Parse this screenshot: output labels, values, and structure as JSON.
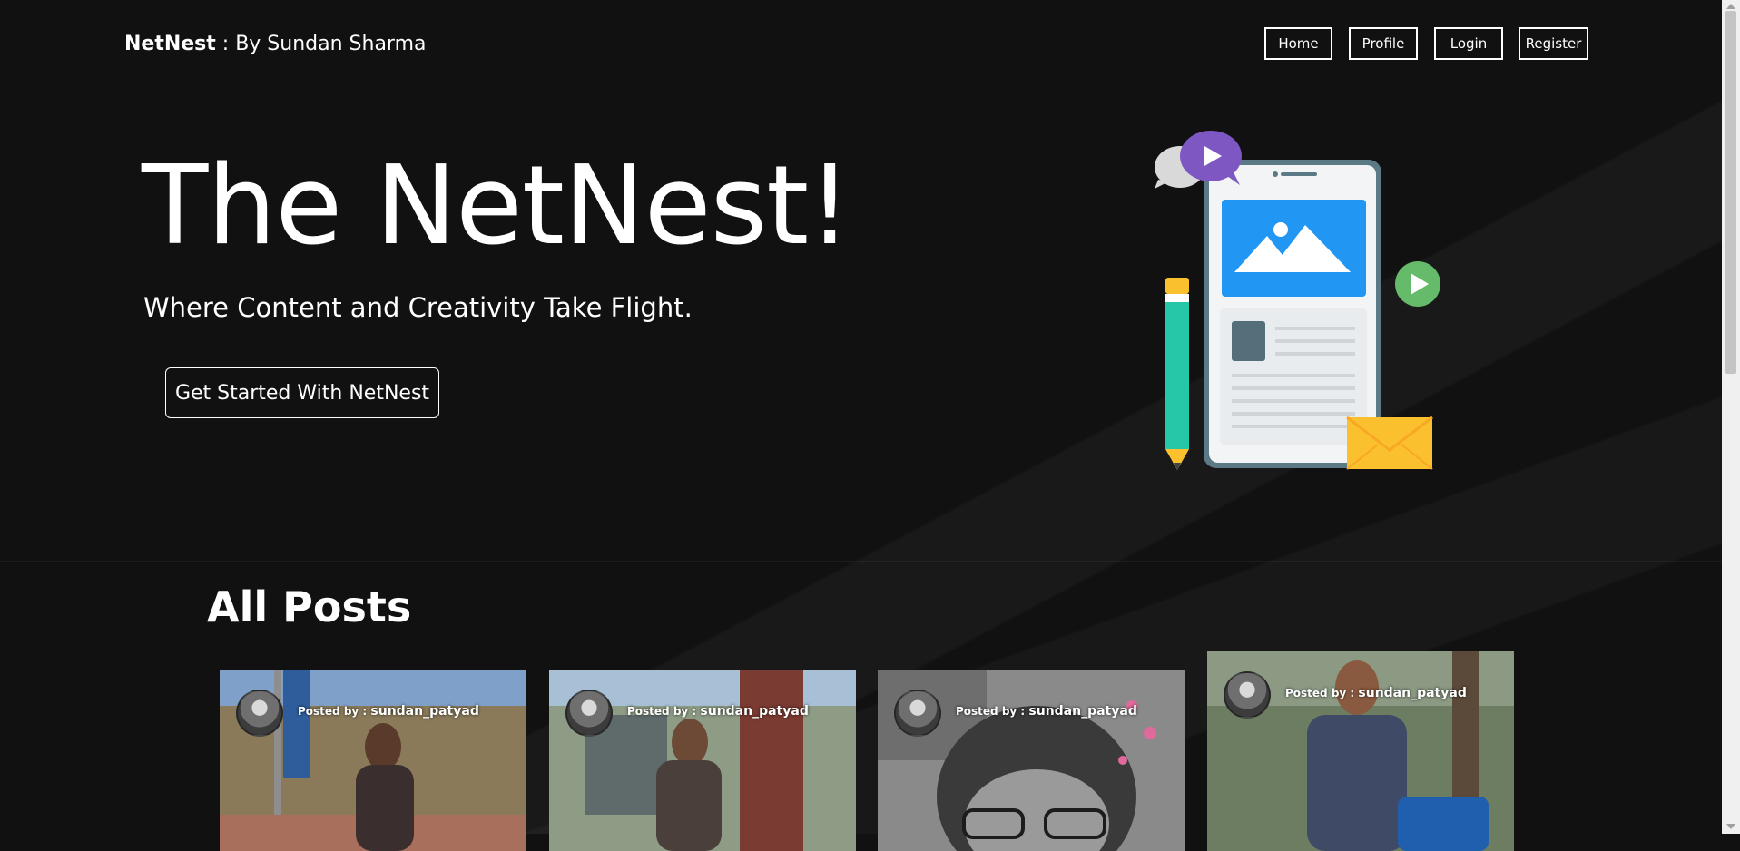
{
  "header": {
    "brand_name": "NetNest",
    "brand_byline": " : By Sundan Sharma",
    "nav": [
      {
        "label": "Home"
      },
      {
        "label": "Profile"
      },
      {
        "label": "Login"
      },
      {
        "label": "Register"
      }
    ]
  },
  "hero": {
    "title": "The NetNest!",
    "subtitle": "Where Content and Creativity Take Flight.",
    "cta_label": "Get Started With NetNest",
    "illustration_icons": [
      "chat-bubble-icon",
      "play-icon",
      "image-icon",
      "pencil-icon",
      "envelope-icon"
    ]
  },
  "posts": {
    "heading": "All Posts",
    "items": [
      {
        "posted_by_label": "Posted by : ",
        "username": "sundan_patyad",
        "photo_colors": [
          "#6f8fb8",
          "#8a7a5a",
          "#a0855e"
        ]
      },
      {
        "posted_by_label": "Posted by : ",
        "username": "sundan_patyad",
        "photo_colors": [
          "#a7c0d6",
          "#7a3b32",
          "#6b6358"
        ]
      },
      {
        "posted_by_label": "Posted by : ",
        "username": "sundan_patyad",
        "photo_colors": [
          "#9a9a9a",
          "#4c4c4c",
          "#2a2a2a"
        ]
      },
      {
        "posted_by_label": "Posted by : ",
        "username": "sundan_patyad",
        "photo_colors": [
          "#6d7d62",
          "#3f4a66",
          "#4b5a3d"
        ]
      }
    ]
  },
  "colors": {
    "background": "#111112",
    "accent_purple": "#7e57c2",
    "accent_blue": "#2196f3",
    "accent_green": "#66bb6a",
    "accent_yellow": "#fbc02d"
  }
}
